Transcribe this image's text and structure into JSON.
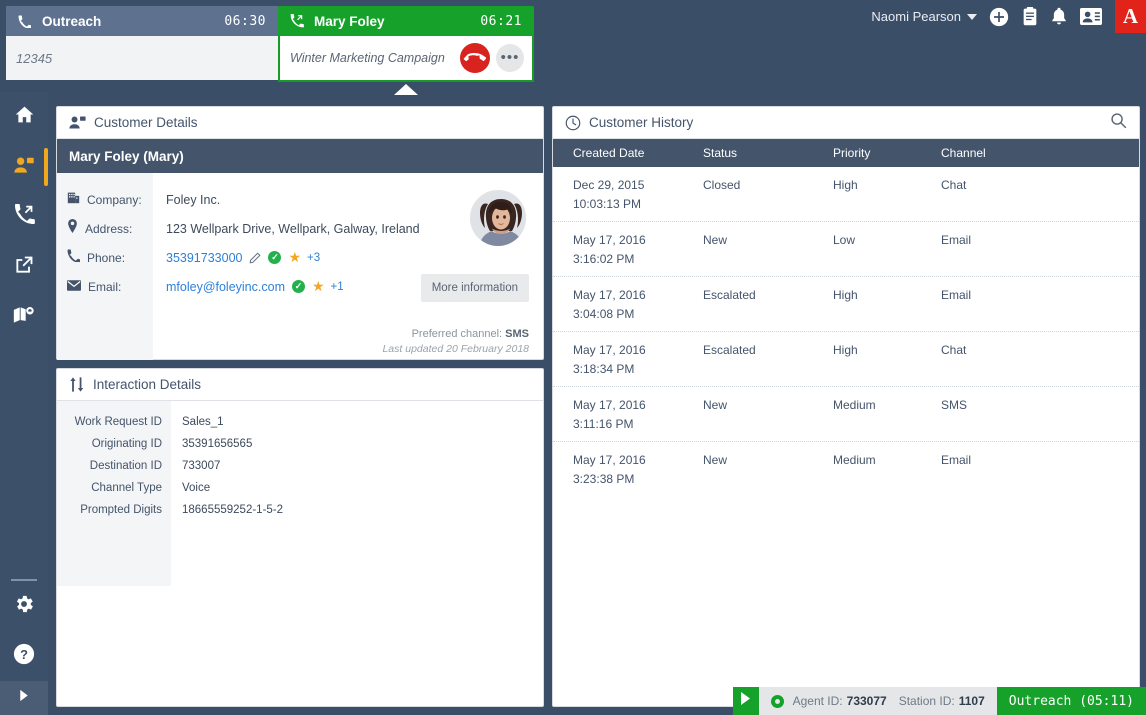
{
  "header": {
    "user_name": "Naomi Pearson",
    "icons": [
      "add-icon",
      "clipboard-icon",
      "bell-icon",
      "contacts-icon"
    ],
    "logo_letter": "A",
    "logo_color": "#e2231a"
  },
  "tabs": {
    "outreach": {
      "icon": "phone-icon",
      "title": "Outreach",
      "timer": "06:30",
      "dial_value": "12345"
    },
    "active": {
      "icon": "incoming-call-icon",
      "title": "Mary Foley",
      "timer": "06:21",
      "campaign": "Winter Marketing Campaign",
      "end_call_label": "end-call",
      "more_label": "•••",
      "accent_color": "#16a22a"
    }
  },
  "sidebar": {
    "items": [
      {
        "name": "home-icon",
        "label": "Home",
        "active": false
      },
      {
        "name": "customer-icon",
        "label": "Customer",
        "active": true
      },
      {
        "name": "callback-icon",
        "label": "Callback",
        "active": false
      },
      {
        "name": "external-link-icon",
        "label": "External",
        "active": false
      },
      {
        "name": "map-icon",
        "label": "Map",
        "active": false
      }
    ],
    "bottom_items": [
      {
        "name": "gear-icon",
        "label": "Settings"
      },
      {
        "name": "help-icon",
        "label": "Help"
      }
    ],
    "expand_icon": "chevron-right-icon",
    "active_color": "#f0a81e"
  },
  "customer_details": {
    "panel_title": "Customer Details",
    "panel_icon": "customer-card-icon",
    "name": "Mary Foley (Mary)",
    "avatar": "customer-avatar",
    "fields": [
      {
        "icon": "building-icon",
        "label": "Company:",
        "value": "Foley Inc."
      },
      {
        "icon": "location-pin-icon",
        "label": "Address:",
        "value": "123 Wellpark Drive, Wellpark, Galway, Ireland"
      },
      {
        "icon": "phone-icon",
        "label": "Phone:",
        "value": "35391733000",
        "link": true,
        "editable": true,
        "verified": true,
        "starred": true,
        "extra": "+3"
      },
      {
        "icon": "envelope-icon",
        "label": "Email:",
        "value": "mfoley@foleyinc.com",
        "link": true,
        "editable": false,
        "verified": true,
        "starred": true,
        "extra": "+1"
      }
    ],
    "more_information_label": "More information",
    "preferred_channel_label": "Preferred channel:",
    "preferred_channel_value": "SMS",
    "last_updated": "Last updated 20 February 2018"
  },
  "interaction_details": {
    "panel_title": "Interaction Details",
    "panel_icon": "transfer-arrows-icon",
    "rows": [
      {
        "label": "Work Request ID",
        "value": "Sales_1"
      },
      {
        "label": "Originating ID",
        "value": "35391656565"
      },
      {
        "label": "Destination ID",
        "value": "733007"
      },
      {
        "label": "Channel Type",
        "value": "Voice"
      },
      {
        "label": "Prompted Digits",
        "value": "18665559252-1-5-2"
      }
    ]
  },
  "customer_history": {
    "panel_title": "Customer History",
    "panel_icon": "clock-icon",
    "search_icon": "search-icon",
    "columns": [
      "Created Date",
      "Status",
      "Priority",
      "Channel"
    ],
    "rows": [
      {
        "date": "Dec 29, 2015",
        "time": "10:03:13 PM",
        "status": "Closed",
        "priority": "High",
        "channel": "Chat"
      },
      {
        "date": "May 17, 2016",
        "time": "3:16:02 PM",
        "status": "New",
        "priority": "Low",
        "channel": "Email"
      },
      {
        "date": "May 17, 2016",
        "time": "3:04:08 PM",
        "status": "Escalated",
        "priority": "High",
        "channel": "Email"
      },
      {
        "date": "May 17, 2016",
        "time": "3:18:34 PM",
        "status": "Escalated",
        "priority": "High",
        "channel": "Chat"
      },
      {
        "date": "May 17, 2016",
        "time": "3:11:16 PM",
        "status": "New",
        "priority": "Medium",
        "channel": "SMS"
      },
      {
        "date": "May 17, 2016",
        "time": "3:23:38 PM",
        "status": "New",
        "priority": "Medium",
        "channel": "Email"
      }
    ]
  },
  "statusbar": {
    "play_icon": "play-icon",
    "status_icon": "ready-status-icon",
    "agent_id_label": "Agent ID:",
    "agent_id_value": "733077",
    "station_id_label": "Station ID:",
    "station_id_value": "1107",
    "campaign_status": "Outreach (05:11)"
  }
}
